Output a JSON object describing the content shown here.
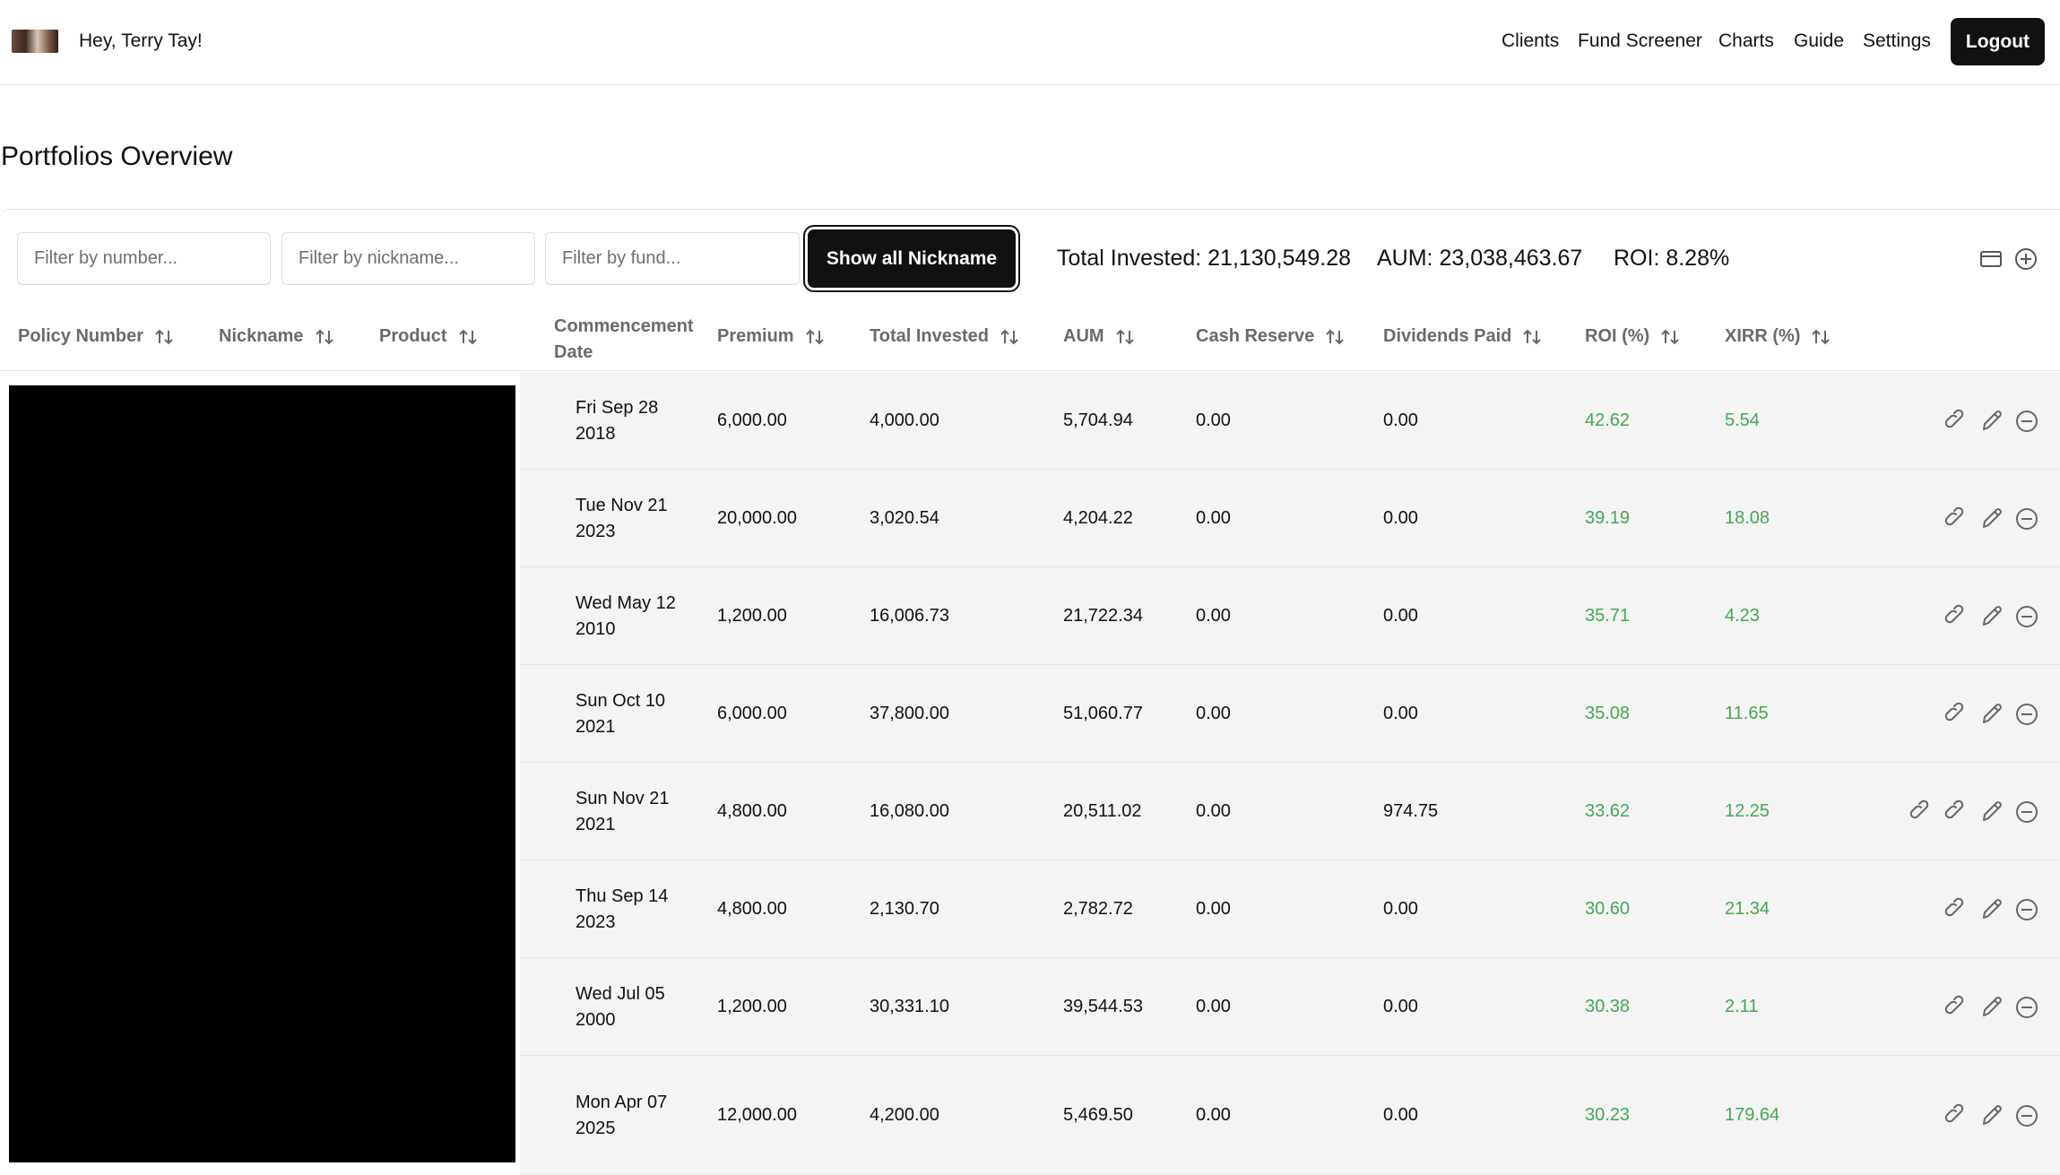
{
  "header": {
    "greeting": "Hey, Terry Tay!",
    "nav": [
      "Clients",
      "Fund Screener",
      "Charts",
      "Guide",
      "Settings"
    ],
    "logout": "Logout"
  },
  "page_title": "Portfolios Overview",
  "filters": {
    "number_placeholder": "Filter by number...",
    "nickname_placeholder": "Filter by nickname...",
    "fund_placeholder": "Filter by fund...",
    "show_button": "Show all Nickname"
  },
  "summary": {
    "total_invested": "Total Invested: 21,130,549.28",
    "aum": "AUM: 23,038,463.67",
    "roi": "ROI: 8.28%"
  },
  "toolbar_icons": [
    "window-icon",
    "add-circle-icon"
  ],
  "columns": {
    "policy_number": "Policy Number",
    "nickname": "Nickname",
    "product": "Product",
    "commencement_date": "Commencement Date",
    "premium": "Premium",
    "total_invested": "Total Invested",
    "aum": "AUM",
    "cash_reserve": "Cash Reserve",
    "dividends_paid": "Dividends Paid",
    "roi": "ROI (%)",
    "xirr": "XIRR (%)"
  },
  "colors": {
    "positive": "#43a854",
    "row_bg": "#f4f4f4",
    "button": "#111111"
  },
  "rows": [
    {
      "date": "Fri Sep 28 2018",
      "premium": "6,000.00",
      "total_invested": "4,000.00",
      "aum": "5,704.94",
      "cash_reserve": "0.00",
      "dividends": "0.00",
      "roi": "42.62",
      "xirr": "5.54",
      "links": 1
    },
    {
      "date": "Tue Nov 21 2023",
      "premium": "20,000.00",
      "total_invested": "3,020.54",
      "aum": "4,204.22",
      "cash_reserve": "0.00",
      "dividends": "0.00",
      "roi": "39.19",
      "xirr": "18.08",
      "links": 1
    },
    {
      "date": "Wed May 12 2010",
      "premium": "1,200.00",
      "total_invested": "16,006.73",
      "aum": "21,722.34",
      "cash_reserve": "0.00",
      "dividends": "0.00",
      "roi": "35.71",
      "xirr": "4.23",
      "links": 1
    },
    {
      "date": "Sun Oct 10 2021",
      "premium": "6,000.00",
      "total_invested": "37,800.00",
      "aum": "51,060.77",
      "cash_reserve": "0.00",
      "dividends": "0.00",
      "roi": "35.08",
      "xirr": "11.65",
      "links": 1
    },
    {
      "date": "Sun Nov 21 2021",
      "premium": "4,800.00",
      "total_invested": "16,080.00",
      "aum": "20,511.02",
      "cash_reserve": "0.00",
      "dividends": "974.75",
      "roi": "33.62",
      "xirr": "12.25",
      "links": 2
    },
    {
      "date": "Thu Sep 14 2023",
      "premium": "4,800.00",
      "total_invested": "2,130.70",
      "aum": "2,782.72",
      "cash_reserve": "0.00",
      "dividends": "0.00",
      "roi": "30.60",
      "xirr": "21.34",
      "links": 1
    },
    {
      "date": "Wed Jul 05 2000",
      "premium": "1,200.00",
      "total_invested": "30,331.10",
      "aum": "39,544.53",
      "cash_reserve": "0.00",
      "dividends": "0.00",
      "roi": "30.38",
      "xirr": "2.11",
      "links": 1
    },
    {
      "date": "Mon Apr 07 2025",
      "premium": "12,000.00",
      "total_invested": "4,200.00",
      "aum": "5,469.50",
      "cash_reserve": "0.00",
      "dividends": "0.00",
      "roi": "30.23",
      "xirr": "179.64",
      "links": 1
    }
  ]
}
